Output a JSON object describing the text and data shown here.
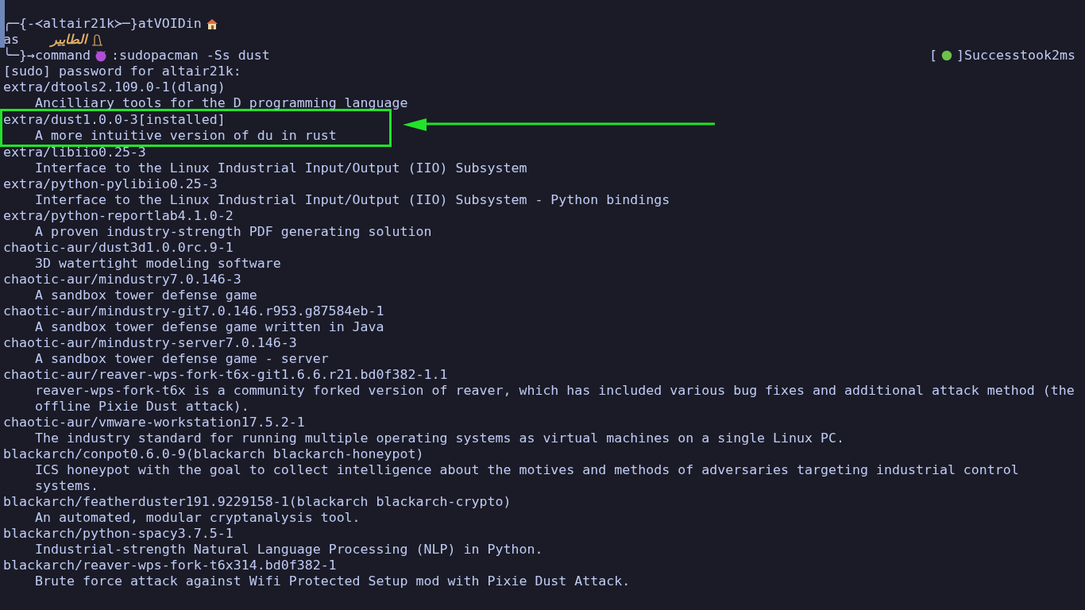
{
  "prompt": {
    "top_prefix": "╭─{-≺",
    "user": "altair21k",
    "top_suffix": "≻─}",
    "at": "at",
    "host": "VOID",
    "in": "in",
    "middle_label": "as",
    "arabic_name": "الطايير",
    "bottom_prefix": "╰─}→",
    "command_label": "command",
    "colon": ":",
    "command": "sudo",
    "args": "pacman -Ss dust",
    "status_open": "[",
    "status_close": "]Success",
    "took": "took",
    "duration": "2ms"
  },
  "output_line": "[sudo] password for altair21k:",
  "packages": [
    {
      "repo": "extra/",
      "name": "dtools",
      "version": "2.109.0-1",
      "groups": "(dlang)",
      "description": "Ancilliary tools for the D programming language",
      "highlighted": false
    },
    {
      "repo": "extra/",
      "name": "dust",
      "version": "1.0.0-3",
      "installed": "[installed]",
      "description": "A more intuitive version of du in rust",
      "highlighted": true
    },
    {
      "repo": "extra/",
      "name": "libiio",
      "version": "0.25-3",
      "description": "Interface to the Linux Industrial Input/Output (IIO) Subsystem",
      "highlighted": false
    },
    {
      "repo": "extra/",
      "name": "python-pylibiio",
      "version": "0.25-3",
      "description": "Interface to the Linux Industrial Input/Output (IIO) Subsystem - Python bindings",
      "highlighted": false
    },
    {
      "repo": "extra/",
      "name": "python-reportlab",
      "version": "4.1.0-2",
      "description": "A proven industry-strength PDF generating solution",
      "highlighted": false
    },
    {
      "repo": "chaotic-aur/",
      "name": "dust3d",
      "version": "1.0.0rc.9-1",
      "description": "3D watertight modeling software",
      "highlighted": false
    },
    {
      "repo": "chaotic-aur/",
      "name": "mindustry",
      "version": "7.0.146-3",
      "description": "A sandbox tower defense game",
      "highlighted": false
    },
    {
      "repo": "chaotic-aur/",
      "name": "mindustry-git",
      "version": "7.0.146.r953.g87584eb-1",
      "description": "A sandbox tower defense game written in Java",
      "highlighted": false
    },
    {
      "repo": "chaotic-aur/",
      "name": "mindustry-server",
      "version": "7.0.146-3",
      "description": "A sandbox tower defense game - server",
      "highlighted": false
    },
    {
      "repo": "chaotic-aur/",
      "name": "reaver-wps-fork-t6x-git",
      "version": "1.6.6.r21.bd0f382-1.1",
      "description": "reaver-wps-fork-t6x is a community forked version of reaver, which has included various bug fixes and additional attack method (the offline Pixie Dust attack).",
      "highlighted": false
    },
    {
      "repo": "chaotic-aur/",
      "name": "vmware-workstation",
      "version": "17.5.2-1",
      "description": "The industry standard for running multiple operating systems as virtual machines on a single Linux PC.",
      "highlighted": false
    },
    {
      "repo": "blackarch/",
      "name": "conpot",
      "version": "0.6.0-9",
      "groups": "(blackarch blackarch-honeypot)",
      "description": "ICS honeypot with the goal to collect intelligence about the motives and methods of adversaries targeting industrial control systems.",
      "highlighted": false
    },
    {
      "repo": "blackarch/",
      "name": "featherduster",
      "version": "191.9229158-1",
      "groups": "(blackarch blackarch-crypto)",
      "description": "An automated, modular cryptanalysis tool.",
      "highlighted": false
    },
    {
      "repo": "blackarch/",
      "name": "python-spacy",
      "version": "3.7.5-1",
      "description": "Industrial-strength Natural Language Processing (NLP) in Python.",
      "highlighted": false
    },
    {
      "repo": "blackarch/",
      "name": "reaver-wps-fork-t6x",
      "version": "314.bd0f382-1",
      "description": "Brute force attack against Wifi Protected Setup mod with Pixie Dust Attack.",
      "highlighted": false
    }
  ]
}
